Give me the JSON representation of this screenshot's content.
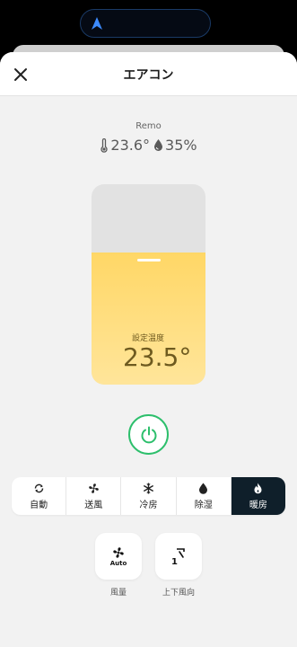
{
  "header": {
    "title": "エアコン"
  },
  "device": {
    "name": "Remo",
    "temperature": "23.6°",
    "humidity": "35%"
  },
  "setpoint": {
    "label": "設定温度",
    "value": "23.5°",
    "fill_fraction": 0.66
  },
  "modes": [
    {
      "label": "自動",
      "icon": "auto-mode-icon",
      "active": false
    },
    {
      "label": "送風",
      "icon": "fan-icon",
      "active": false
    },
    {
      "label": "冷房",
      "icon": "snowflake-icon",
      "active": false
    },
    {
      "label": "除湿",
      "icon": "droplet-icon",
      "active": false
    },
    {
      "label": "暖房",
      "icon": "flame-icon",
      "active": true
    }
  ],
  "options": {
    "fan_speed": {
      "label": "風量",
      "value": "Auto"
    },
    "vertical_louver": {
      "label": "上下風向",
      "value": "1"
    }
  },
  "colors": {
    "accent_green": "#2dbf6c",
    "warm_fill": "#ffd766",
    "active_mode_bg": "#0f1f2a"
  }
}
